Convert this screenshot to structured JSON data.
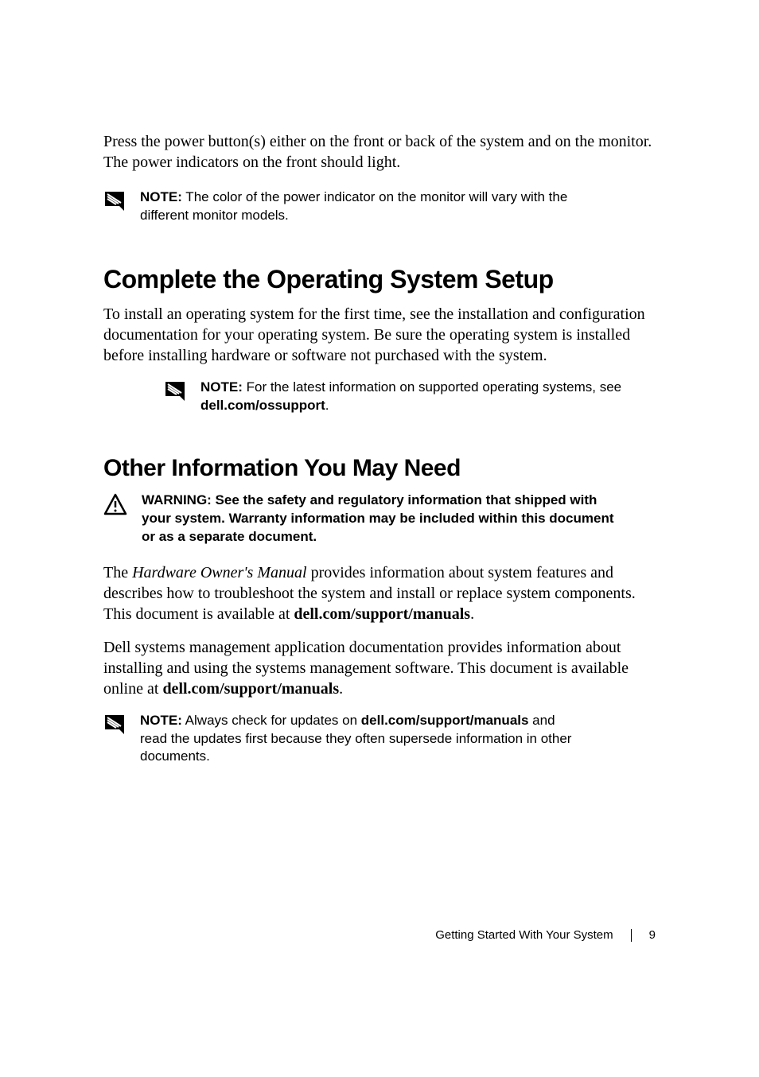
{
  "intro": "Press the power button(s) either on the front or back of the system and on the monitor. The power indicators on the front should light.",
  "note1": {
    "label": "NOTE:",
    "text": " The color of the power indicator on the monitor will vary with the different monitor models."
  },
  "heading1": "Complete the Operating System Setup",
  "para1": "To install an operating system for the first time, see the installation and configuration documentation for your operating system. Be sure the operating system is installed before installing hardware or software not purchased with the system.",
  "note2": {
    "label": "NOTE:",
    "text_prefix": " For the latest information on supported operating systems, see ",
    "bold": "dell.com/ossupport",
    "text_suffix": "."
  },
  "heading2": "Other Information You May Need",
  "warning": {
    "label": "WARNING:",
    "text": " See the safety and regulatory information that shipped with your system. Warranty information may be included within this document or as a separate document."
  },
  "para2": {
    "prefix": "The ",
    "italic": "Hardware Owner's Manual",
    "mid": " provides information about system features and describes how to troubleshoot the system and install or replace system components. This document is available at ",
    "bold": "dell.com/support/manuals",
    "suffix": "."
  },
  "para3": {
    "prefix": "Dell systems management application documentation provides information about installing and using the systems management software. This document is available online at ",
    "bold": "dell.com/support/manuals",
    "suffix": "."
  },
  "note3": {
    "label": "NOTE:",
    "text_prefix": " Always check for updates on ",
    "bold": "dell.com/support/manuals",
    "text_suffix": " and read the updates first because they often supersede information in other documents."
  },
  "footer": {
    "title": "Getting Started With Your System",
    "page": "9"
  }
}
